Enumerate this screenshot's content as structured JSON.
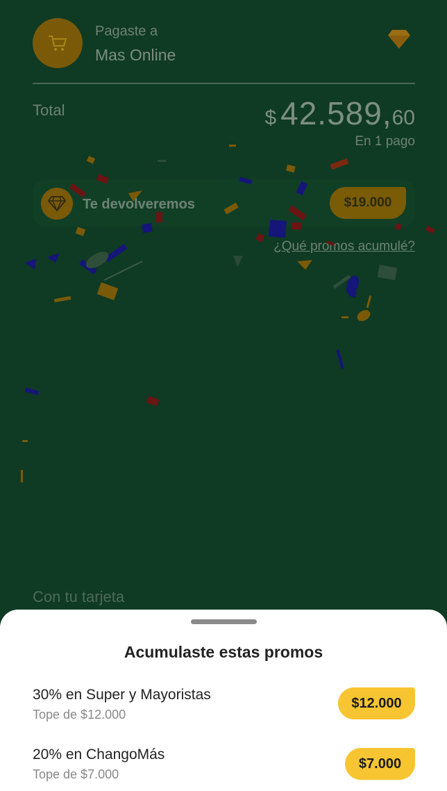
{
  "header": {
    "paid_label": "Pagaste a",
    "merchant_name": "Mas Online",
    "merchant_icon": "shopping-cart-icon",
    "tier_icon": "diamond-icon"
  },
  "total": {
    "label": "Total",
    "currency": "$",
    "integer": "42.589,",
    "decimals": "60",
    "installments": "En 1 pago"
  },
  "cashback": {
    "icon": "diamond-icon",
    "label": "Te devolveremos",
    "amount": "$19.000"
  },
  "promos_link": "¿Qué promos acumulé?",
  "card_label": "Con tu tarjeta",
  "sheet": {
    "title": "Acumulaste estas promos",
    "promos": [
      {
        "title": "30% en Super y Mayoristas",
        "cap": "Tope de $12.000",
        "amount": "$12.000"
      },
      {
        "title": "20% en ChangoMás",
        "cap": "Tope de $7.000",
        "amount": "$7.000"
      }
    ]
  },
  "colors": {
    "background": "#0f3a23",
    "accent_dim": "#7a5a08",
    "badge_yellow": "#f7c532",
    "sheet_background": "#ffffff"
  }
}
